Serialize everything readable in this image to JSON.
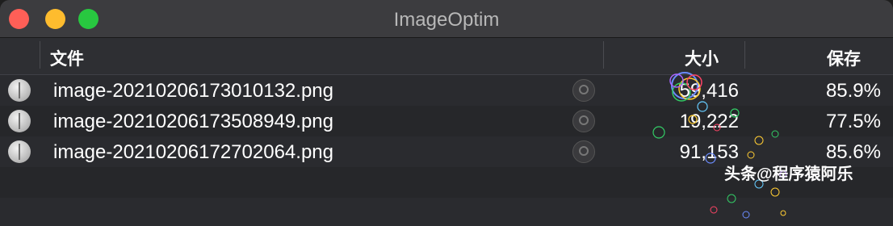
{
  "app": {
    "title": "ImageOptim"
  },
  "columns": {
    "file": "文件",
    "size": "大小",
    "saved": "保存"
  },
  "files": [
    {
      "name": "image-20210206173010132.png",
      "size": "59,416",
      "saved": "85.9%"
    },
    {
      "name": "image-20210206173508949.png",
      "size": "19,222",
      "saved": "77.5%"
    },
    {
      "name": "image-20210206172702064.png",
      "size": "91,153",
      "saved": "85.6%"
    }
  ],
  "watermark": "头条@程序猿阿乐",
  "colors": {
    "close": "#fe5f57",
    "minimize": "#febc2e",
    "maximize": "#28c840"
  }
}
